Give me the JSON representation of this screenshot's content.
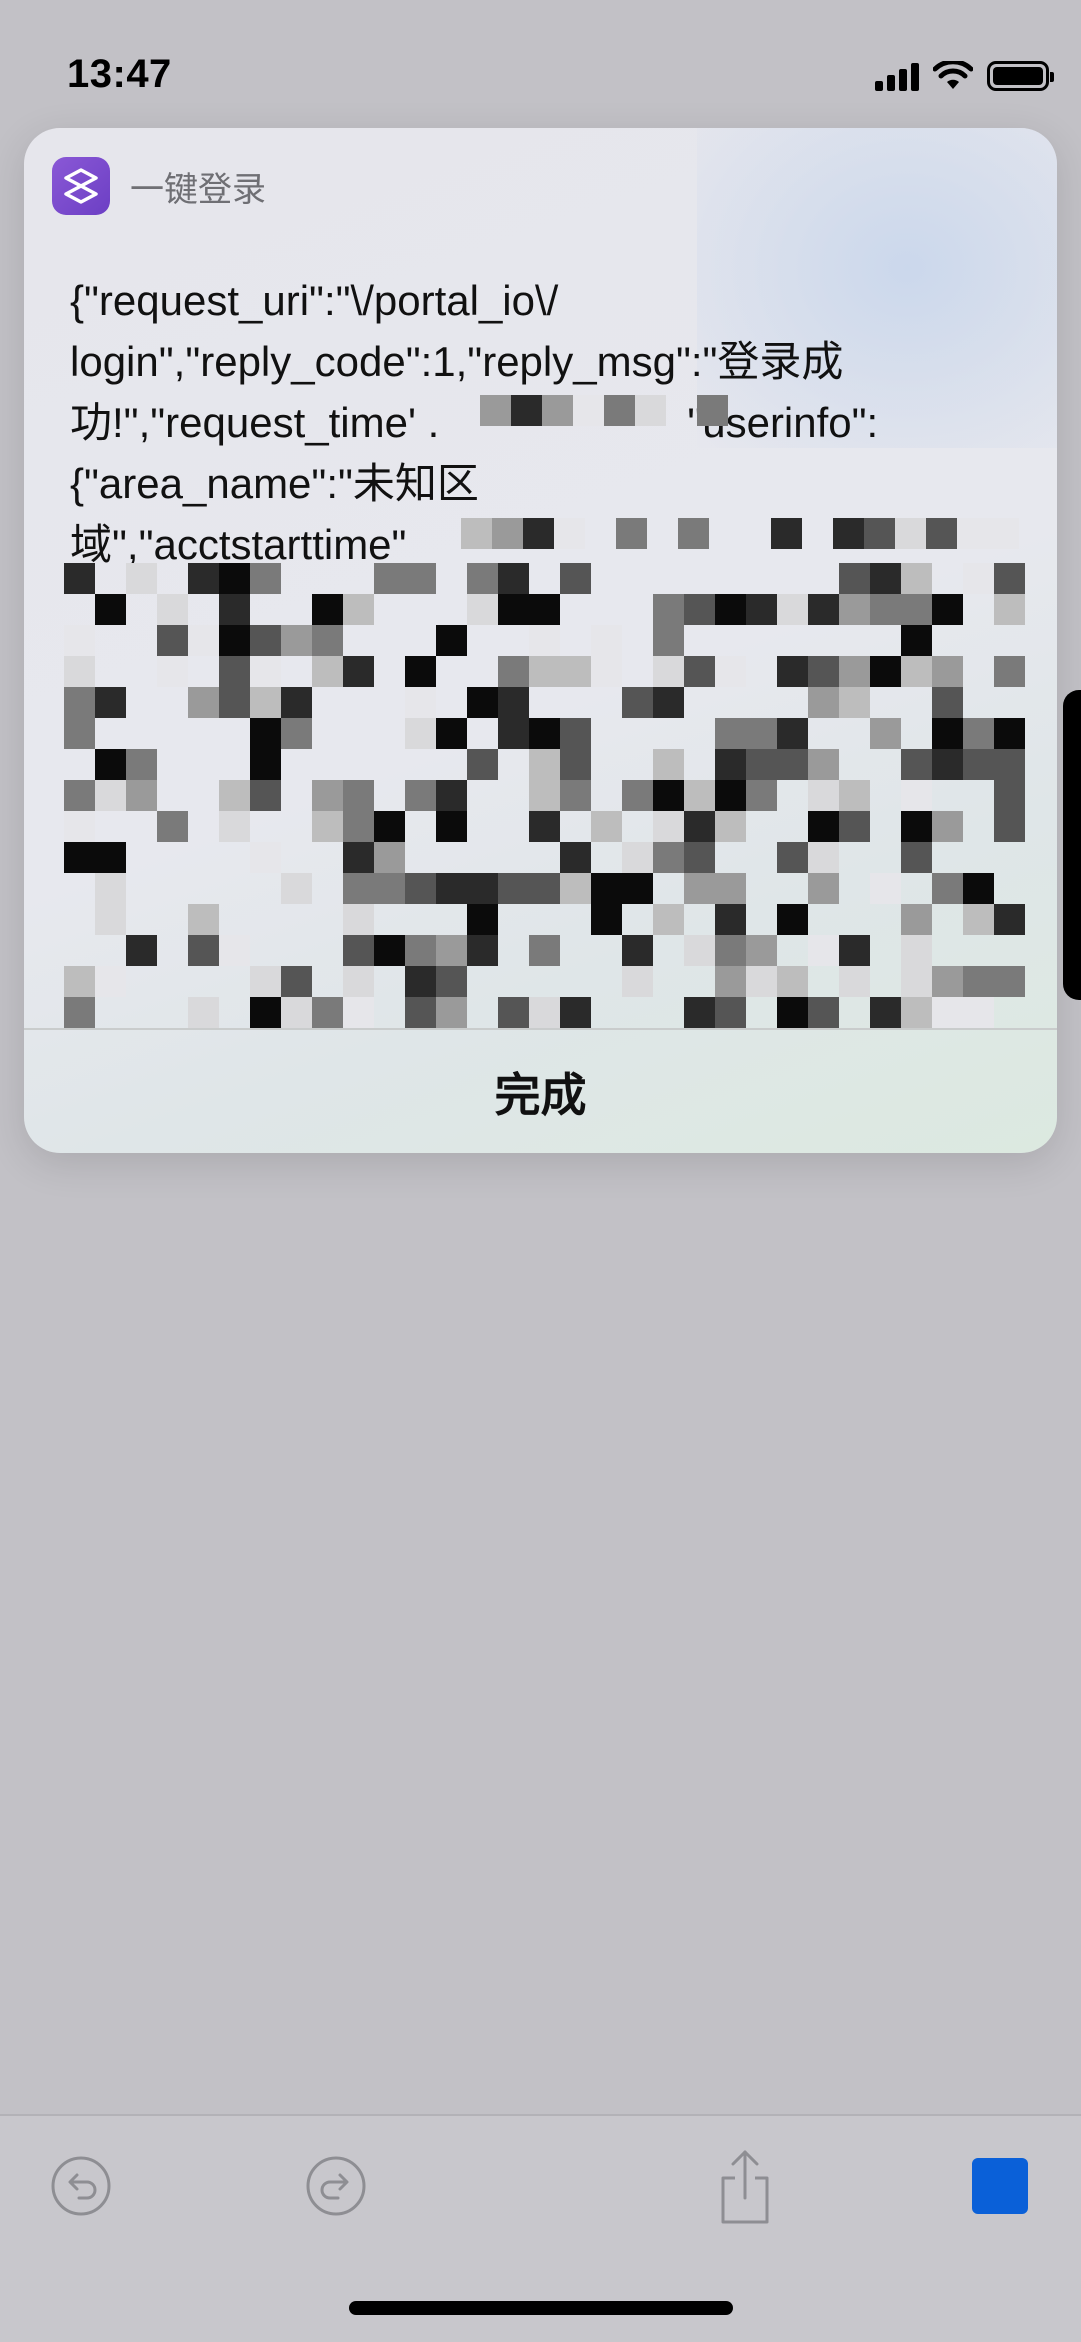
{
  "status_bar": {
    "time": "13:47",
    "signal_icon": "cellular-signal-icon",
    "wifi_icon": "wifi-icon",
    "battery_icon": "battery-icon"
  },
  "notification": {
    "app_icon": "shortcuts-icon",
    "app_name": "一键登录",
    "message_lines": [
      "{\"request_uri\":\"\\/portal_io\\/",
      "login\",\"reply_code\":1,\"reply_msg\":\"登录成",
      "功!\",\"request_time' .",
      "{\"area_name\":\"未知区",
      "域\",\"acctstarttime\""
    ],
    "message_line3_tail": "\"userinfo\":",
    "done_label": "完成"
  },
  "toolbar": {
    "undo_icon": "undo-icon",
    "redo_icon": "redo-icon",
    "share_icon": "share-icon",
    "stop_icon": "stop-icon",
    "stop_color": "#0a60d8"
  }
}
